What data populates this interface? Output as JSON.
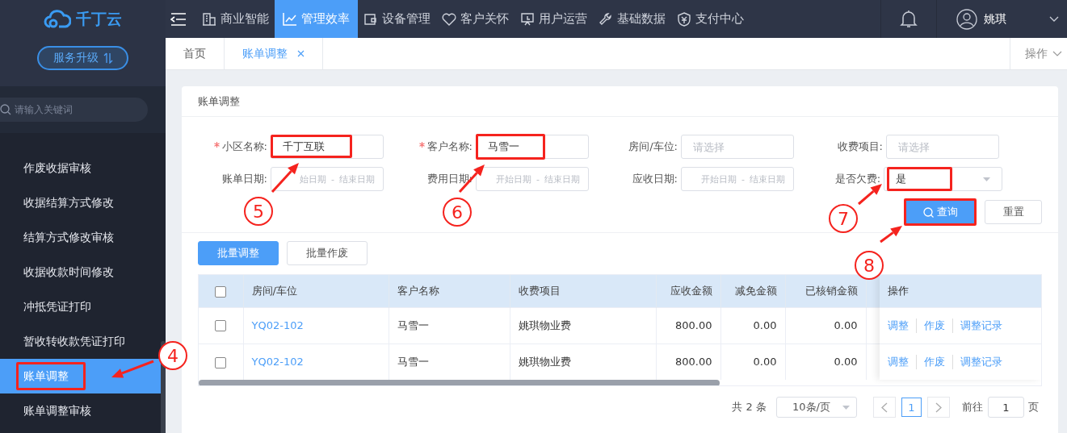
{
  "logo": {
    "text": "千丁云"
  },
  "sidebar": {
    "upgrade_button": "服务升级",
    "search": {
      "placeholder": "请输入关键词"
    },
    "items": [
      {
        "label": "作废收据审核",
        "selected": false
      },
      {
        "label": "收据结算方式修改",
        "selected": false
      },
      {
        "label": "结算方式修改审核",
        "selected": false
      },
      {
        "label": "收据收款时间修改",
        "selected": false
      },
      {
        "label": "冲抵凭证打印",
        "selected": false
      },
      {
        "label": "暂收转收款凭证打印",
        "selected": false
      },
      {
        "label": "账单调整",
        "selected": true
      },
      {
        "label": "账单调整审核",
        "selected": false
      }
    ]
  },
  "nav": {
    "items": [
      {
        "label": "商业智能",
        "selected": false
      },
      {
        "label": "管理效率",
        "selected": true
      },
      {
        "label": "设备管理",
        "selected": false
      },
      {
        "label": "客户关怀",
        "selected": false
      },
      {
        "label": "用户运营",
        "selected": false
      },
      {
        "label": "基础数据",
        "selected": false
      },
      {
        "label": "支付中心",
        "selected": false
      }
    ],
    "user": "姚琪"
  },
  "tabs": {
    "items": [
      {
        "label": "首页",
        "selected": false,
        "closable": false
      },
      {
        "label": "账单调整",
        "selected": true,
        "closable": true
      }
    ],
    "actions": "操作"
  },
  "card": {
    "title": "账单调整",
    "filters": [
      {
        "kind": "text",
        "label": "小区名称:",
        "required": true,
        "value": "千丁互联"
      },
      {
        "kind": "text",
        "label": "客户名称:",
        "required": true,
        "value": "马雪一"
      },
      {
        "kind": "text",
        "label": "房间/车位:",
        "required": false,
        "placeholder": "请选择"
      },
      {
        "kind": "text",
        "label": "收费项目:",
        "required": false,
        "placeholder": "请选择"
      },
      {
        "kind": "date",
        "label": "账单日期:",
        "required": false,
        "start_placeholder": "始日期",
        "separator": "-",
        "end_placeholder": "结束日期"
      },
      {
        "kind": "date",
        "label": "费用日期:",
        "required": false,
        "start_placeholder": "开始日期",
        "separator": "-",
        "end_placeholder": "结束日期"
      },
      {
        "kind": "date",
        "label": "应收日期:",
        "required": false,
        "start_placeholder": "开始日期",
        "separator": "-",
        "end_placeholder": "结束日期"
      },
      {
        "kind": "select",
        "label": "是否欠费:",
        "required": false,
        "value": "是"
      }
    ],
    "search_button": "查询",
    "reset_button": "重置",
    "batch_buttons": [
      {
        "label": "批量调整",
        "primary": true
      },
      {
        "label": "批量作废",
        "primary": false
      }
    ],
    "table": {
      "select_all_checked": false,
      "columns": [
        "房间/车位",
        "客户名称",
        "收费项目",
        "应收金额",
        "减免金额",
        "已核销金额"
      ],
      "actions_column": "操作",
      "rows": [
        {
          "checked": false,
          "cells": [
            "YQ02-102",
            "马雪一",
            "姚琪物业费",
            "800.00",
            "0.00",
            "0.00"
          ],
          "actions": [
            "调整",
            "作废",
            "调整记录"
          ]
        },
        {
          "checked": false,
          "cells": [
            "YQ02-102",
            "马雪一",
            "姚琪物业费",
            "800.00",
            "0.00",
            "0.00"
          ],
          "actions": [
            "调整",
            "作废",
            "调整记录"
          ]
        }
      ]
    },
    "pagination": {
      "total": "共 2 条",
      "page_size": "10条/页",
      "pages": [
        {
          "label": "1",
          "selected": true
        }
      ],
      "goto_label": "前往",
      "goto_value": "1",
      "page_unit": "页"
    }
  },
  "annotations": [
    {
      "label": "4"
    },
    {
      "label": "5"
    },
    {
      "label": "6"
    },
    {
      "label": "7"
    },
    {
      "label": "8"
    }
  ]
}
